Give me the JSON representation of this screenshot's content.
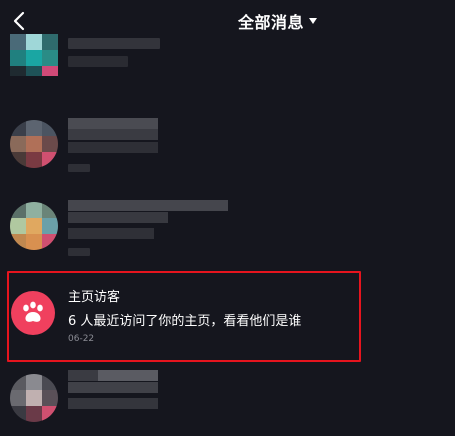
{
  "header": {
    "back_icon": "chevron-left-icon",
    "title": "全部消息",
    "dropdown_icon": "caret-down-icon"
  },
  "visitor_notification": {
    "icon": "paw-icon",
    "title": "主页访客",
    "message": "6 人最近访问了你的主页，看看他们是谁",
    "date": "06-22",
    "highlight_color": "#e6141e",
    "icon_bg_color": "#f0405e"
  },
  "colors": {
    "background": "#15161e",
    "text_primary": "#ffffff",
    "text_secondary": "#8a8b93"
  }
}
